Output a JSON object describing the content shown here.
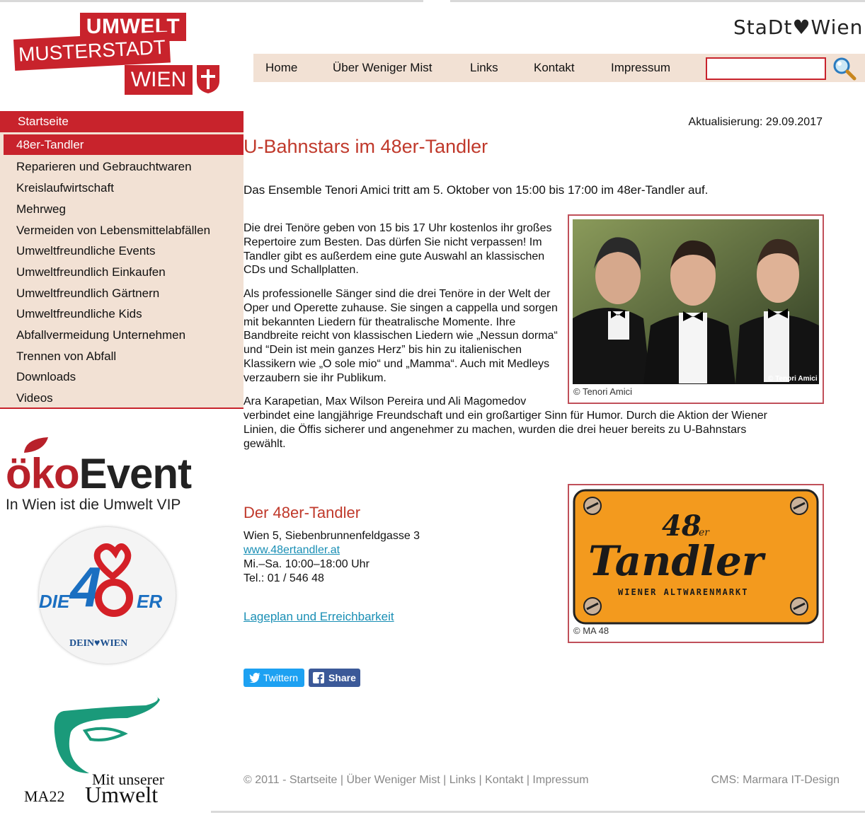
{
  "header": {
    "logo": {
      "line1": "UMWELT",
      "line2": "MUSTERSTADT",
      "line3": "WIEN"
    },
    "stadt_logo": "StaDt♥Wien"
  },
  "nav": {
    "items": [
      "Home",
      "Über Weniger Mist",
      "Links",
      "Kontakt",
      "Impressum"
    ],
    "search_value": ""
  },
  "sidebar": {
    "start": "Startseite",
    "active": "48er-Tandler",
    "items": [
      "Reparieren und Gebrauchtwaren",
      "Kreislaufwirtschaft",
      "Mehrweg",
      "Vermeiden von Lebensmittelabfällen",
      "Umweltfreundliche Events",
      "Umweltfreundlich Einkaufen",
      "Umweltfreundlich Gärtnern",
      "Umweltfreundliche Kids",
      "Abfallvermeidung Unternehmen",
      "Trennen von Abfall",
      "Downloads",
      "Videos"
    ]
  },
  "side_logos": {
    "oko_part1": "öko",
    "oko_part2": "Event",
    "oko_sub": "In Wien ist die Umwelt VIP",
    "die48_die": "DIE",
    "die48_er": "ER",
    "die48_sub": "DEIN♥WIEN",
    "ma22_line1": "Mit unserer",
    "ma22_line2": "MA22",
    "ma22_line3": "Umwelt"
  },
  "content": {
    "updated": "Aktualisierung: 29.09.2017",
    "title": "U-Bahnstars im 48er-Tandler",
    "lead": "Das Ensemble Tenori Amici tritt am 5. Oktober von 15:00 bis 17:00 im 48er-Tandler auf.",
    "p1": "Die drei Tenöre geben von 15 bis 17 Uhr kostenlos ihr großes Repertoire zum Besten. Das dürfen Sie nicht verpassen! Im Tandler gibt es außerdem eine gute Auswahl an klassischen CDs und Schallplatten.",
    "p2": "Als professionelle Sänger sind die drei Tenöre in der Welt der Oper und Operette zuhause. Sie singen a cappella und sorgen mit bekannten Liedern für theatralische Momente. Ihre Bandbreite reicht von klassischen Liedern wie „Nessun dorma“ und “Dein ist mein ganzes Herz” bis hin zu italienischen Klassikern wie „O sole mio“ und „Mamma“. Auch mit Medleys verzaubern sie ihr Publikum.",
    "p3a": "Ara Karapetian, Max Wilson Pereira und Ali Magomedov",
    "p3b": "verbindet eine langjährige Freundschaft und ein großartiger Sinn für Humor. Durch die Aktion der Wiener Linien, die Öffis sicherer und angenehmer zu machen, wurden die drei heuer bereits zu U-Bahnstars gewählt.",
    "photo_watermark": "© Tenori Amici",
    "photo_caption": "© Tenori Amici",
    "tandler_num": "48",
    "tandler_er": "er",
    "tandler_word": "Tandler",
    "tandler_sub": "WIENER ALTWARENMARKT",
    "tandler_caption": "© MA 48",
    "sub_title": "Der 48er-Tandler",
    "address": "Wien 5, Siebenbrunnenfeldgasse 3",
    "website": "www.48ertandler.at",
    "hours": "Mi.–Sa. 10:00–18:00 Uhr",
    "phone": "Tel.: 01 / 546 48",
    "map_link": "Lageplan und Erreichbarkeit",
    "twitter_label": "Twittern",
    "share_label": "Share"
  },
  "footer": {
    "left": "© 2011 - Startseite | Über Weniger Mist | Links | Kontakt | Impressum",
    "right": "CMS: Marmara IT-Design"
  },
  "colors": {
    "brand_red": "#c8232c",
    "beige": "#f2e1d4",
    "link": "#1a8fb5"
  }
}
